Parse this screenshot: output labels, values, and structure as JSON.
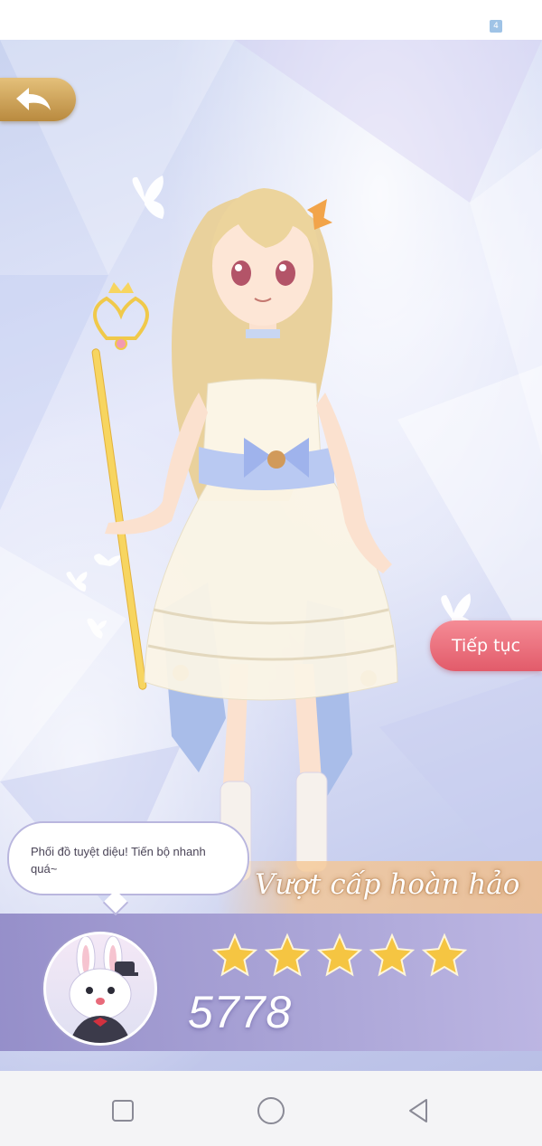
{
  "status_bar": {
    "badge": "4"
  },
  "game": {
    "back_icon": "back-arrow-icon",
    "continue_label": "Tiếp tục",
    "speech_text": "Phối đồ tuyệt diệu! Tiến bộ nhanh quá~",
    "rank_title": "Vượt cấp hoàn hảo",
    "stars": 5,
    "score": "5778",
    "avatar_icon": "bunny-mascot-icon",
    "colors": {
      "back": "#c9a059",
      "continue": "#ec6f7c",
      "panel": "#a39dd4",
      "star": "#f5c542"
    }
  },
  "nav": {
    "recent_icon": "square-recent-apps-icon",
    "home_icon": "circle-home-icon",
    "back_icon": "triangle-back-icon"
  }
}
